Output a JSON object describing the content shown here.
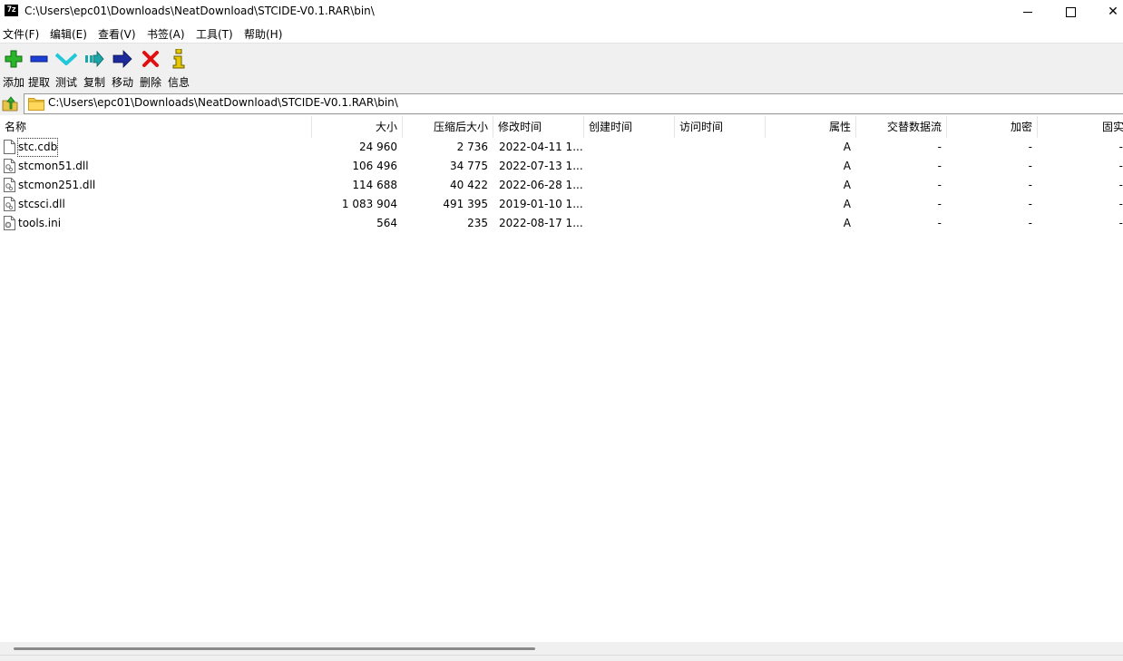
{
  "window": {
    "app_icon_text": "7z",
    "title": "C:\\Users\\epc01\\Downloads\\NeatDownload\\STCIDE-V0.1.RAR\\bin\\",
    "minimize_icon": "minimize-icon",
    "maximize_icon": "maximize-icon",
    "close_icon": "close-icon",
    "close_glyph": "✕"
  },
  "menu": [
    {
      "label": "文件(F)"
    },
    {
      "label": "编辑(E)"
    },
    {
      "label": "查看(V)"
    },
    {
      "label": "书签(A)"
    },
    {
      "label": "工具(T)"
    },
    {
      "label": "帮助(H)"
    }
  ],
  "toolbar": [
    {
      "label": "添加",
      "icon": "plus-icon",
      "color": "#2bb32b"
    },
    {
      "label": "提取",
      "icon": "minus-icon",
      "color": "#1c3fd6"
    },
    {
      "label": "测试",
      "icon": "check-chevron-icon",
      "color": "#21c8d8"
    },
    {
      "label": "复制",
      "icon": "copy-arrow-icon",
      "color": "#1aa6a6"
    },
    {
      "label": "移动",
      "icon": "move-arrow-icon",
      "color": "#1c2a9c"
    },
    {
      "label": "删除",
      "icon": "delete-x-icon",
      "color": "#e01010"
    },
    {
      "label": "信息",
      "icon": "info-icon",
      "color": "#e6c800"
    }
  ],
  "address": {
    "up_icon": "folder-up-icon",
    "folder_icon": "folder-icon",
    "path": "C:\\Users\\epc01\\Downloads\\NeatDownload\\STCIDE-V0.1.RAR\\bin\\"
  },
  "columns": [
    {
      "label": "名称",
      "align": "left"
    },
    {
      "label": "大小",
      "align": "right"
    },
    {
      "label": "压缩后大小",
      "align": "right"
    },
    {
      "label": "修改时间",
      "align": "left"
    },
    {
      "label": "创建时间",
      "align": "left"
    },
    {
      "label": "访问时间",
      "align": "left"
    },
    {
      "label": "属性",
      "align": "right"
    },
    {
      "label": "交替数据流",
      "align": "right"
    },
    {
      "label": "加密",
      "align": "right"
    },
    {
      "label": "固实",
      "align": "right"
    }
  ],
  "files": [
    {
      "name": "stc.cdb",
      "icon": "file-icon",
      "size": "24 960",
      "packed": "2 736",
      "modified": "2022-04-11 1...",
      "created": "",
      "accessed": "",
      "attr": "A",
      "ads": "-",
      "encrypted": "-",
      "solid": "-"
    },
    {
      "name": "stcmon51.dll",
      "icon": "dll-file-icon",
      "size": "106 496",
      "packed": "34 775",
      "modified": "2022-07-13 1...",
      "created": "",
      "accessed": "",
      "attr": "A",
      "ads": "-",
      "encrypted": "-",
      "solid": "-"
    },
    {
      "name": "stcmon251.dll",
      "icon": "dll-file-icon",
      "size": "114 688",
      "packed": "40 422",
      "modified": "2022-06-28 1...",
      "created": "",
      "accessed": "",
      "attr": "A",
      "ads": "-",
      "encrypted": "-",
      "solid": "-"
    },
    {
      "name": "stcsci.dll",
      "icon": "dll-file-icon",
      "size": "1 083 904",
      "packed": "491 395",
      "modified": "2019-01-10 1...",
      "created": "",
      "accessed": "",
      "attr": "A",
      "ads": "-",
      "encrypted": "-",
      "solid": "-"
    },
    {
      "name": "tools.ini",
      "icon": "ini-file-icon",
      "size": "564",
      "packed": "235",
      "modified": "2022-08-17 1...",
      "created": "",
      "accessed": "",
      "attr": "A",
      "ads": "-",
      "encrypted": "-",
      "solid": "-"
    }
  ]
}
